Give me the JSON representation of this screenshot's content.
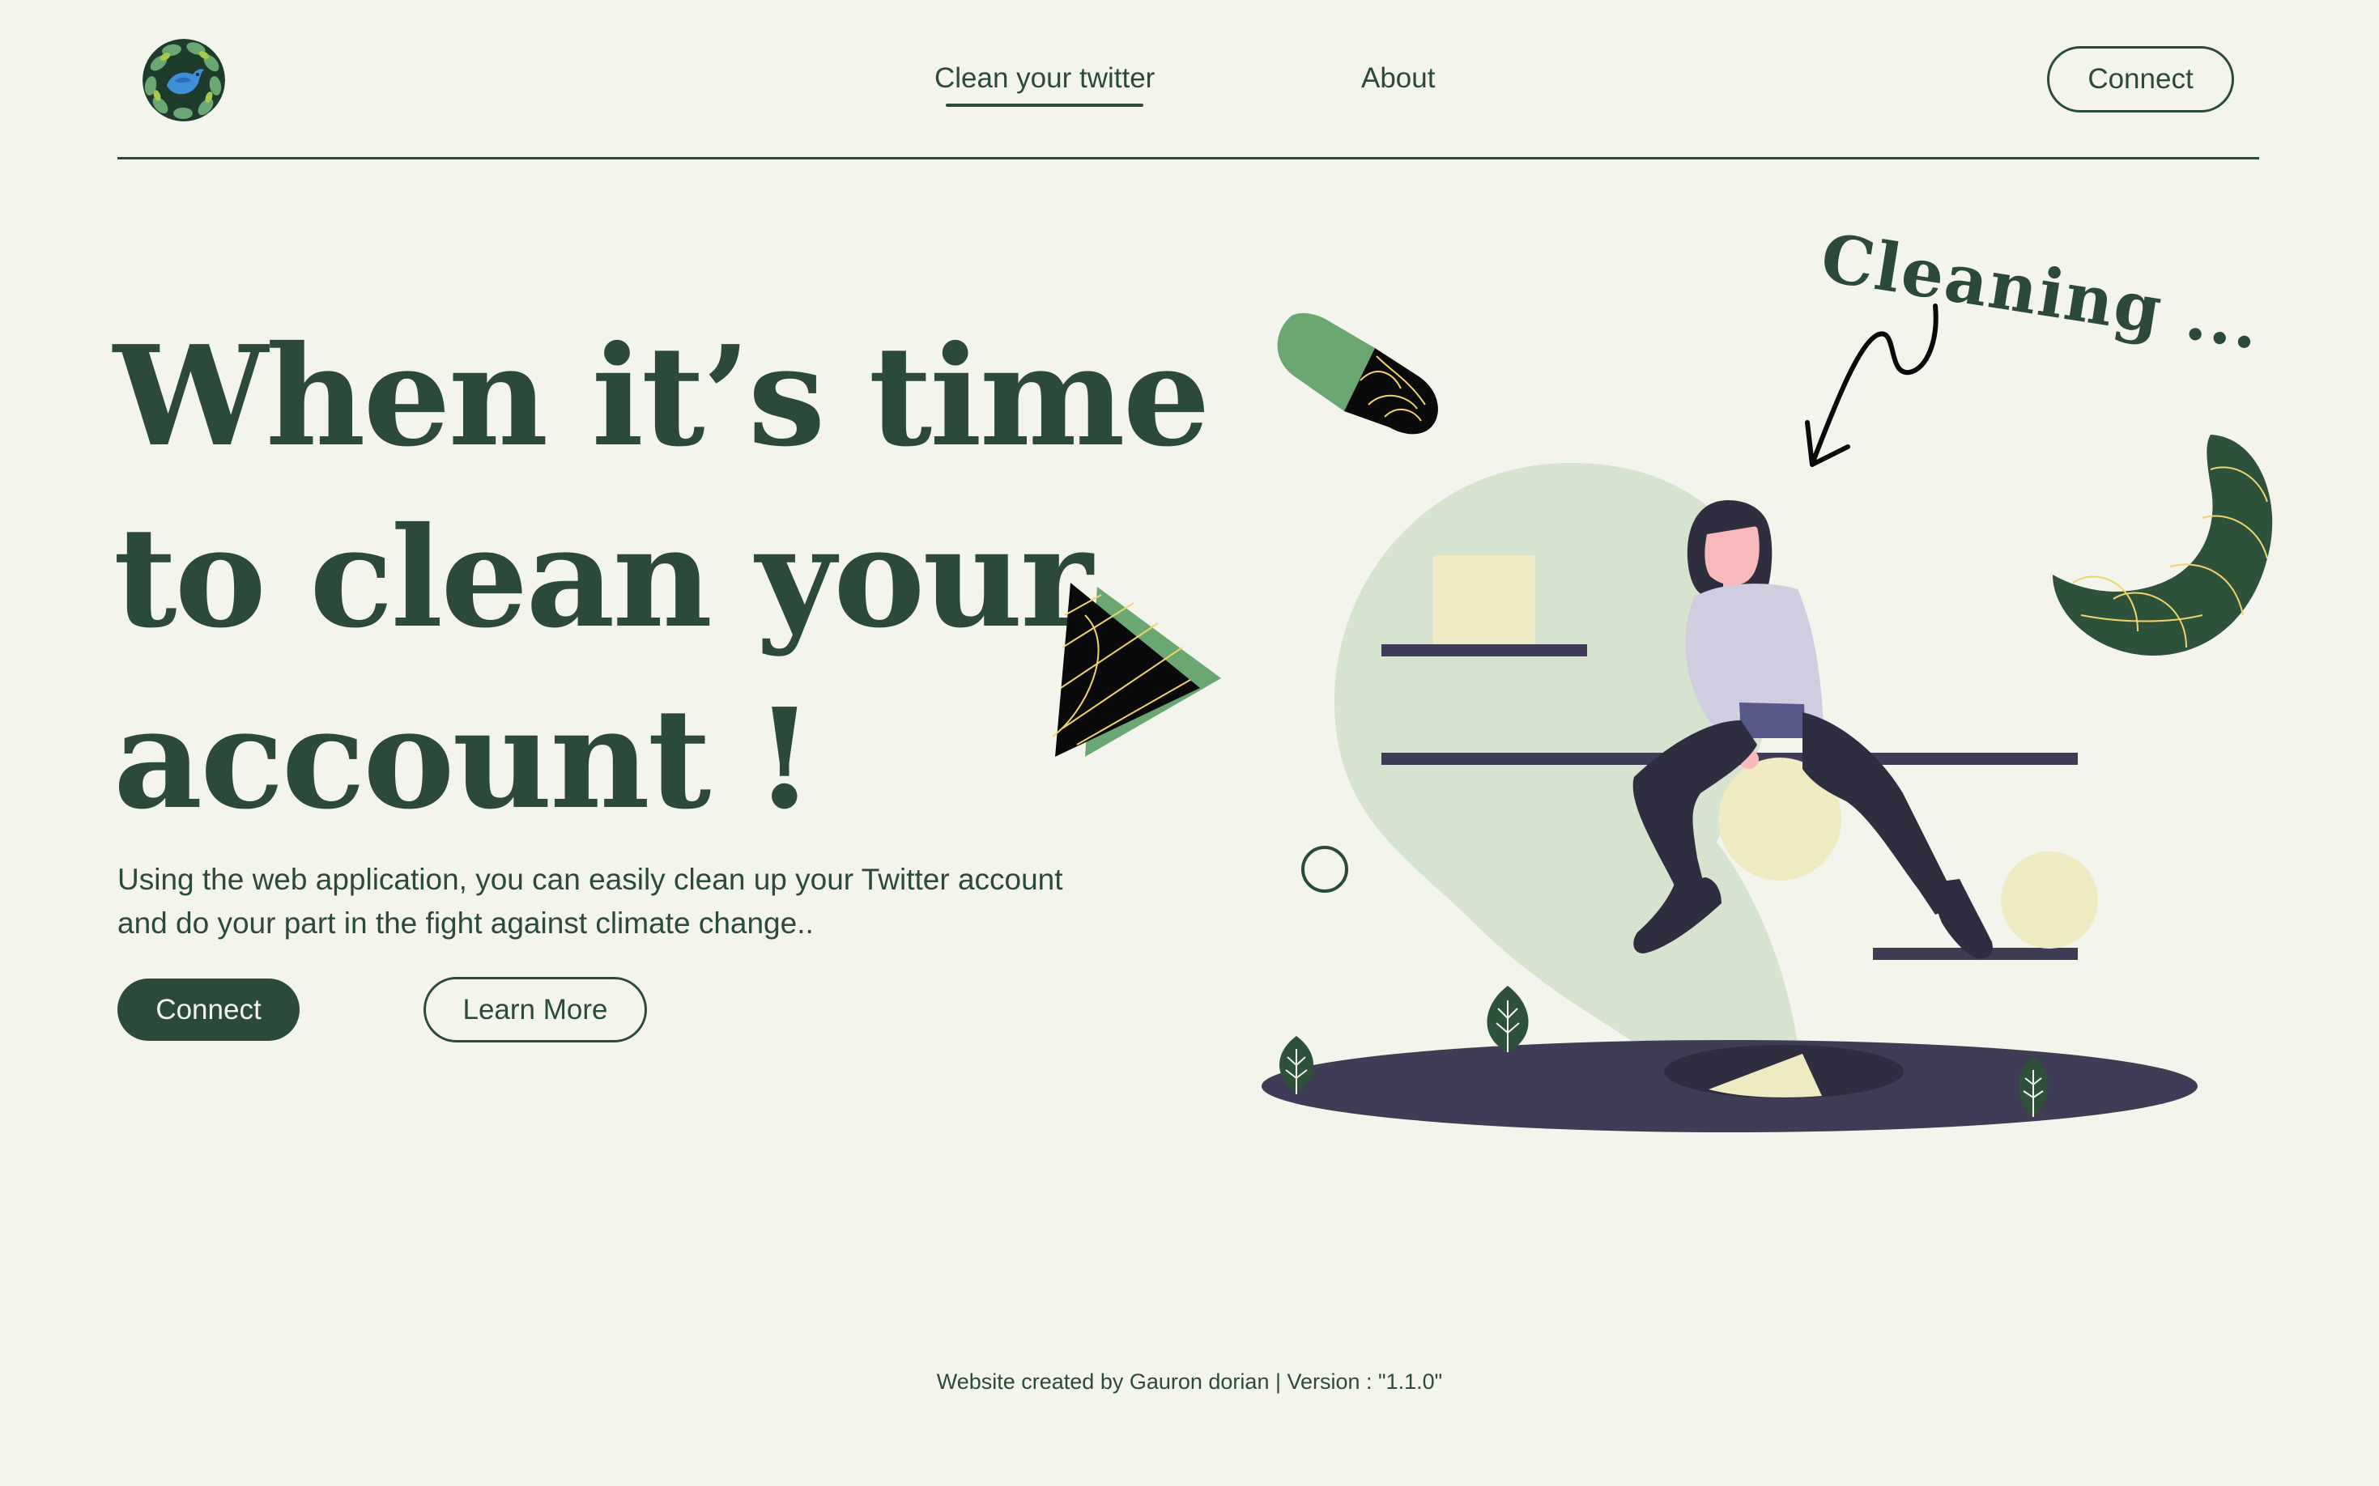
{
  "header": {
    "logo_icon": "bird-leaves-logo",
    "nav": [
      {
        "label": "Clean your twitter",
        "active": true
      },
      {
        "label": "About",
        "active": false
      }
    ],
    "connect_label": "Connect"
  },
  "hero": {
    "title_lines": [
      "When it’s time",
      "to clean your",
      "account !"
    ],
    "description_lines": [
      "Using the web application, you can easily clean up your Twitter account",
      "and do your part in the fight against climate change.."
    ],
    "connect_label": "Connect",
    "learn_more_label": "Learn More"
  },
  "illustration": {
    "caption": "Cleaning ..."
  },
  "footer": {
    "text": "Website created by Gauron dorian | Version : \"1.1.0\""
  },
  "colors": {
    "background": "#f3f4ec",
    "primary": "#2b4a3a",
    "accent_green": "#6aa772",
    "pale_green": "#d5e3cf",
    "pale_yellow": "#efeac2",
    "dark_navy": "#3f3d56"
  }
}
